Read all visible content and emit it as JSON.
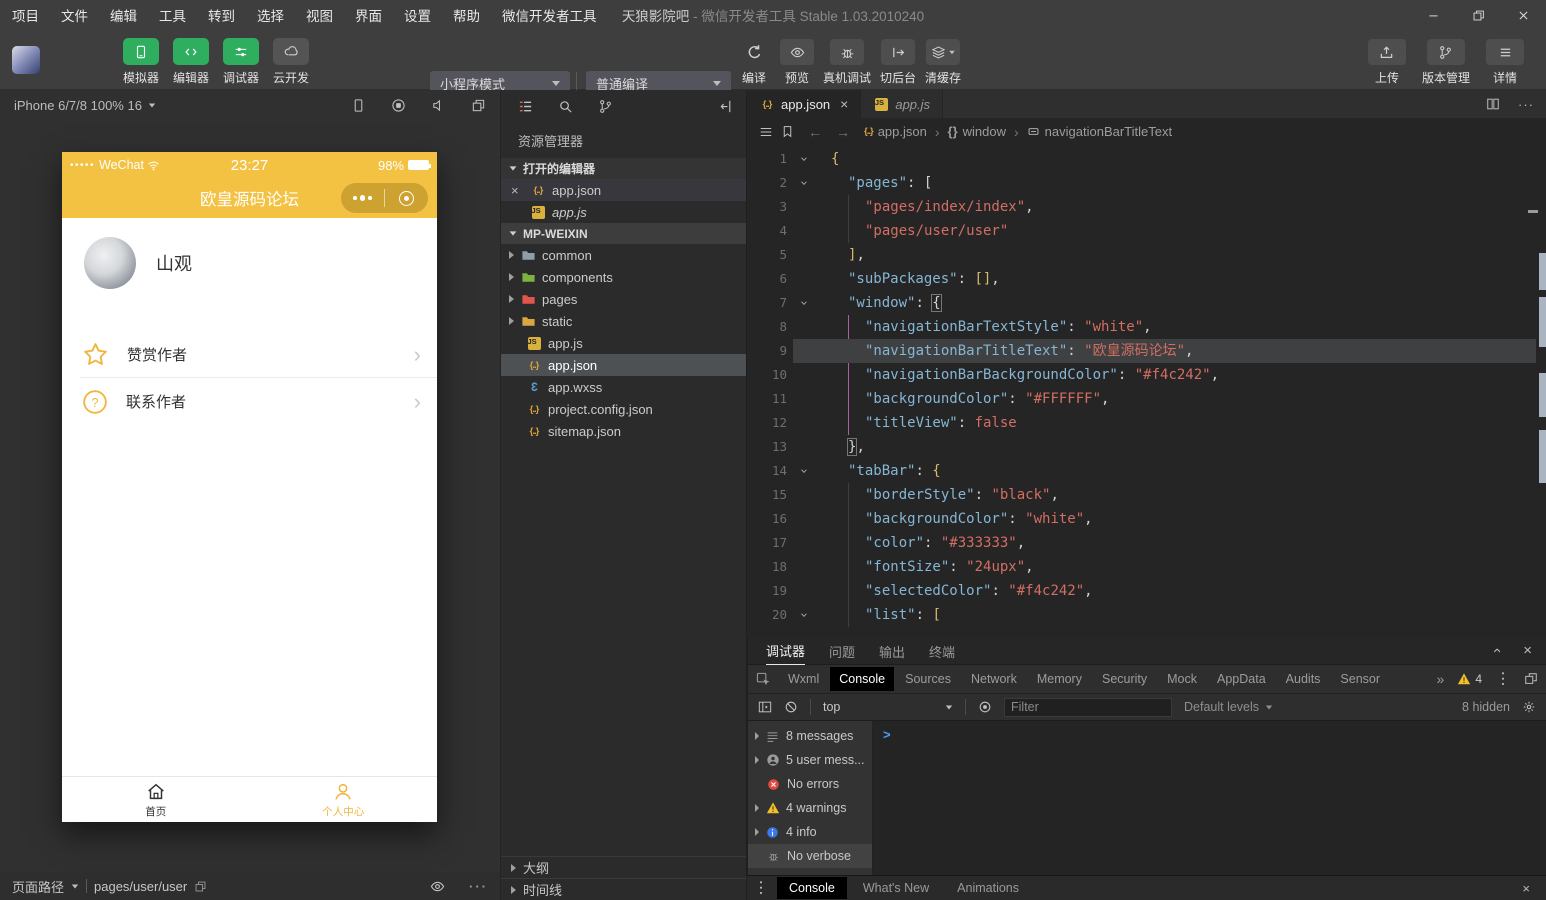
{
  "window_bar": {
    "menus": [
      "项目",
      "文件",
      "编辑",
      "工具",
      "转到",
      "选择",
      "视图",
      "界面",
      "设置",
      "帮助",
      "微信开发者工具"
    ],
    "title_project": "天狼影院吧",
    "title_app": "- 微信开发者工具 Stable 1.03.2010240",
    "window_controls": [
      "minimize-icon",
      "restore-icon",
      "close-icon"
    ]
  },
  "toolbar": {
    "sim_buttons": [
      {
        "label": "模拟器",
        "icon": "phone-icon",
        "style": "green"
      },
      {
        "label": "编辑器",
        "icon": "code-icon",
        "style": "green"
      },
      {
        "label": "调试器",
        "icon": "sliders-icon",
        "style": "green"
      },
      {
        "label": "云开发",
        "icon": "cloud-icon",
        "style": "gray"
      }
    ],
    "mode_dropdown": "小程序模式",
    "compile_dropdown": "普通编译",
    "actions": [
      {
        "label": "编译",
        "icon": "refresh-icon",
        "boxed": false
      },
      {
        "label": "预览",
        "icon": "eye-icon",
        "boxed": true
      },
      {
        "label": "真机调试",
        "icon": "bug-icon",
        "boxed": true
      },
      {
        "label": "切后台",
        "icon": "to-background-icon",
        "boxed": true
      },
      {
        "label": "清缓存",
        "icon": "layers-icon",
        "boxed": true,
        "caret": true
      }
    ],
    "right_actions": [
      {
        "label": "上传",
        "icon": "upload-icon"
      },
      {
        "label": "版本管理",
        "icon": "branch-icon"
      },
      {
        "label": "详情",
        "icon": "details-icon"
      }
    ]
  },
  "simulator": {
    "device": "iPhone 6/7/8 100% 16",
    "toolbar_icons": [
      "device-icon",
      "record-icon",
      "mute-icon",
      "multi-window-icon"
    ],
    "status": {
      "carrier": "WeChat",
      "time": "23:27",
      "battery": "98%"
    },
    "nav_title": "欧皇源码论坛",
    "accent_color": "#f4c242",
    "profile_name": "山观",
    "menu": [
      {
        "label": "赞赏作者",
        "icon": "star-icon"
      },
      {
        "label": "联系作者",
        "icon": "question-icon"
      }
    ],
    "tabbar": [
      {
        "label": "首页",
        "icon": "home-icon",
        "selected": false
      },
      {
        "label": "个人中心",
        "icon": "person-icon",
        "selected": true
      }
    ],
    "page_path_label": "页面路径",
    "page_path": "pages/user/user",
    "pagebar_icons": [
      "eye-icon",
      "more-dots-icon"
    ]
  },
  "explorer": {
    "toolbar_icons": [
      "files-list-icon",
      "search-icon",
      "branch-icon"
    ],
    "collapse_icon": "collapse-panel-icon",
    "title": "资源管理器",
    "sections": {
      "open_editors": "打开的编辑器",
      "project": "MP-WEIXIN"
    },
    "open_editors": [
      {
        "name": "app.json",
        "type": "json",
        "active": true
      },
      {
        "name": "app.js",
        "type": "js",
        "preview": true
      }
    ],
    "tree": [
      {
        "name": "common",
        "type": "folder",
        "color": "#909ea8"
      },
      {
        "name": "components",
        "type": "folder",
        "color": "#7cb342"
      },
      {
        "name": "pages",
        "type": "folder",
        "color": "#e25549"
      },
      {
        "name": "static",
        "type": "folder",
        "color": "#d9a741"
      },
      {
        "name": "app.js",
        "type": "js"
      },
      {
        "name": "app.json",
        "type": "json",
        "selected": true
      },
      {
        "name": "app.wxss",
        "type": "wxss"
      },
      {
        "name": "project.config.json",
        "type": "json"
      },
      {
        "name": "sitemap.json",
        "type": "json"
      }
    ],
    "bottom_sections": [
      "大纲",
      "时间线"
    ]
  },
  "editor": {
    "tabs": [
      {
        "name": "app.json",
        "type": "json",
        "active": true
      },
      {
        "name": "app.js",
        "type": "js",
        "active": false
      }
    ],
    "tab_action_icons": [
      "split-editor-icon",
      "more-actions-icon"
    ],
    "breadcrumb_icons": [
      "list-icon",
      "bookmark-icon"
    ],
    "breadcrumb": [
      {
        "label": "app.json",
        "icon": "json-file-icon"
      },
      {
        "label": "window",
        "icon": "object-icon"
      },
      {
        "label": "navigationBarTitleText",
        "icon": "property-icon"
      }
    ],
    "lines": [
      {
        "n": 1,
        "ind": 0,
        "fold": true,
        "t": [
          [
            "b",
            "{"
          ]
        ]
      },
      {
        "n": 2,
        "ind": 1,
        "fold": true,
        "t": [
          [
            "k",
            "\"pages\""
          ],
          [
            "p",
            ": "
          ],
          [
            "p",
            "["
          ]
        ]
      },
      {
        "n": 3,
        "ind": 2,
        "t": [
          [
            "s",
            "\"pages/index/index\""
          ],
          [
            "p",
            ","
          ]
        ]
      },
      {
        "n": 4,
        "ind": 2,
        "t": [
          [
            "s",
            "\"pages/user/user\""
          ]
        ]
      },
      {
        "n": 5,
        "ind": 1,
        "t": [
          [
            "b",
            "]"
          ],
          [
            "p",
            ","
          ]
        ]
      },
      {
        "n": 6,
        "ind": 1,
        "t": [
          [
            "k",
            "\"subPackages\""
          ],
          [
            "p",
            ": "
          ],
          [
            "b",
            "[]"
          ],
          [
            "p",
            ","
          ]
        ]
      },
      {
        "n": 7,
        "ind": 1,
        "fold": true,
        "t": [
          [
            "k",
            "\"window\""
          ],
          [
            "p",
            ": "
          ],
          [
            "m",
            "{"
          ]
        ]
      },
      {
        "n": 8,
        "ind": 2,
        "t": [
          [
            "k",
            "\"navigationBarTextStyle\""
          ],
          [
            "p",
            ": "
          ],
          [
            "s",
            "\"white\""
          ],
          [
            "p",
            ","
          ]
        ]
      },
      {
        "n": 9,
        "ind": 2,
        "hl": true,
        "t": [
          [
            "k",
            "\"navigationBarTitleText\""
          ],
          [
            "p",
            ": "
          ],
          [
            "s",
            "\"欧皇源码论坛\""
          ],
          [
            "p",
            ","
          ]
        ]
      },
      {
        "n": 10,
        "ind": 2,
        "t": [
          [
            "k",
            "\"navigationBarBackgroundColor\""
          ],
          [
            "p",
            ": "
          ],
          [
            "s",
            "\"#f4c242\""
          ],
          [
            "p",
            ","
          ]
        ]
      },
      {
        "n": 11,
        "ind": 2,
        "t": [
          [
            "k",
            "\"backgroundColor\""
          ],
          [
            "p",
            ": "
          ],
          [
            "s",
            "\"#FFFFFF\""
          ],
          [
            "p",
            ","
          ]
        ]
      },
      {
        "n": 12,
        "ind": 2,
        "t": [
          [
            "k",
            "\"titleView\""
          ],
          [
            "p",
            ": "
          ],
          [
            "w",
            "false"
          ]
        ]
      },
      {
        "n": 13,
        "ind": 1,
        "t": [
          [
            "m",
            "}"
          ],
          [
            "p",
            ","
          ]
        ]
      },
      {
        "n": 14,
        "ind": 1,
        "fold": true,
        "t": [
          [
            "k",
            "\"tabBar\""
          ],
          [
            "p",
            ": "
          ],
          [
            "b",
            "{"
          ]
        ]
      },
      {
        "n": 15,
        "ind": 2,
        "t": [
          [
            "k",
            "\"borderStyle\""
          ],
          [
            "p",
            ": "
          ],
          [
            "s",
            "\"black\""
          ],
          [
            "p",
            ","
          ]
        ]
      },
      {
        "n": 16,
        "ind": 2,
        "t": [
          [
            "k",
            "\"backgroundColor\""
          ],
          [
            "p",
            ": "
          ],
          [
            "s",
            "\"white\""
          ],
          [
            "p",
            ","
          ]
        ]
      },
      {
        "n": 17,
        "ind": 2,
        "t": [
          [
            "k",
            "\"color\""
          ],
          [
            "p",
            ": "
          ],
          [
            "s",
            "\"#333333\""
          ],
          [
            "p",
            ","
          ]
        ]
      },
      {
        "n": 18,
        "ind": 2,
        "t": [
          [
            "k",
            "\"fontSize\""
          ],
          [
            "p",
            ": "
          ],
          [
            "s",
            "\"24upx\""
          ],
          [
            "p",
            ","
          ]
        ]
      },
      {
        "n": 19,
        "ind": 2,
        "t": [
          [
            "k",
            "\"selectedColor\""
          ],
          [
            "p",
            ": "
          ],
          [
            "s",
            "\"#f4c242\""
          ],
          [
            "p",
            ","
          ]
        ]
      },
      {
        "n": 20,
        "ind": 2,
        "fold": true,
        "t": [
          [
            "k",
            "\"list\""
          ],
          [
            "p",
            ": "
          ],
          [
            "b",
            "["
          ]
        ]
      }
    ]
  },
  "debugger": {
    "panel_tabs": [
      {
        "label": "调试器",
        "active": true
      },
      {
        "label": "问题",
        "active": false
      },
      {
        "label": "输出",
        "active": false
      },
      {
        "label": "终端",
        "active": false
      }
    ],
    "header_icons": [
      "collapse-up-icon",
      "close-icon"
    ],
    "devtools_tabs": [
      {
        "label": "Wxml",
        "active": false
      },
      {
        "label": "Console",
        "active": true
      },
      {
        "label": "Sources",
        "active": false
      },
      {
        "label": "Network",
        "active": false
      },
      {
        "label": "Memory",
        "active": false
      },
      {
        "label": "Security",
        "active": false
      },
      {
        "label": "Mock",
        "active": false
      },
      {
        "label": "AppData",
        "active": false
      },
      {
        "label": "Audits",
        "active": false
      },
      {
        "label": "Sensor",
        "active": false
      }
    ],
    "more_tabs_glyph": "»",
    "warning_count": "4",
    "context": "top",
    "filter_placeholder": "Filter",
    "levels_label": "Default levels",
    "hidden_label": "8 hidden",
    "toolbar_icons": [
      "sidebar-toggle-icon",
      "clear-console-icon"
    ],
    "sidebar": [
      {
        "label": "8 messages",
        "icon": "messages",
        "arrow": true,
        "selected": false
      },
      {
        "label": "5 user mess...",
        "icon": "user",
        "arrow": true,
        "selected": false
      },
      {
        "label": "No errors",
        "icon": "error",
        "arrow": false,
        "selected": false
      },
      {
        "label": "4 warnings",
        "icon": "warning",
        "arrow": true,
        "selected": false
      },
      {
        "label": "4 info",
        "icon": "info",
        "arrow": true,
        "selected": false
      },
      {
        "label": "No verbose",
        "icon": "verbose",
        "arrow": false,
        "selected": true
      }
    ],
    "prompt_glyph": ">",
    "drawer_tabs": [
      {
        "label": "Console",
        "active": true
      },
      {
        "label": "What's New",
        "active": false
      },
      {
        "label": "Animations",
        "active": false
      }
    ]
  }
}
